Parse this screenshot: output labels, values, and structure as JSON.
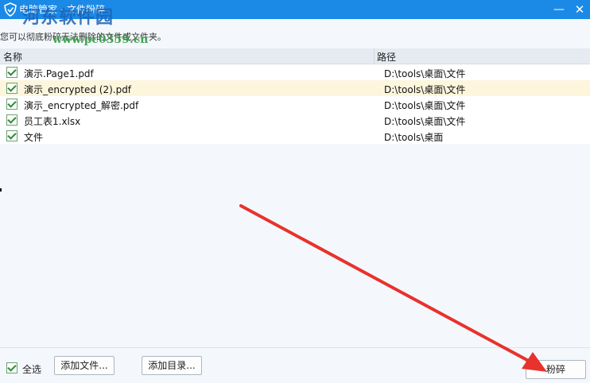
{
  "window": {
    "title": "电脑管家 - 文件粉碎",
    "minimize_glyph": "—",
    "close_glyph": "✕"
  },
  "hint_text": "您可以彻底粉碎无法删除的文件或文件夹。",
  "watermark": {
    "line1": "河东软件园",
    "line2": "www.pc0359.cn"
  },
  "table": {
    "columns": [
      "名称",
      "路径"
    ],
    "rows": [
      {
        "name": "演示.Page1.pdf",
        "path": "D:\\tools\\桌面\\文件",
        "checked": true,
        "selected": false
      },
      {
        "name": "演示_encrypted (2).pdf",
        "path": "D:\\tools\\桌面\\文件",
        "checked": true,
        "selected": true
      },
      {
        "name": "演示_encrypted_解密.pdf",
        "path": "D:\\tools\\桌面\\文件",
        "checked": true,
        "selected": false
      },
      {
        "name": "员工表1.xlsx",
        "path": "D:\\tools\\桌面\\文件",
        "checked": true,
        "selected": false
      },
      {
        "name": "文件",
        "path": "D:\\tools\\桌面",
        "checked": true,
        "selected": false
      }
    ]
  },
  "footer": {
    "select_all_label": "全选",
    "select_all_checked": true,
    "add_file_label": "添加文件...",
    "add_dir_label": "添加目录...",
    "shred_label": "粉碎"
  },
  "colors": {
    "title_bar": "#1a8ae6",
    "annotation_arrow": "#e8322d",
    "selected_row": "#fdf6dd"
  },
  "icons": {
    "app_logo": "shield-logo-icon"
  }
}
